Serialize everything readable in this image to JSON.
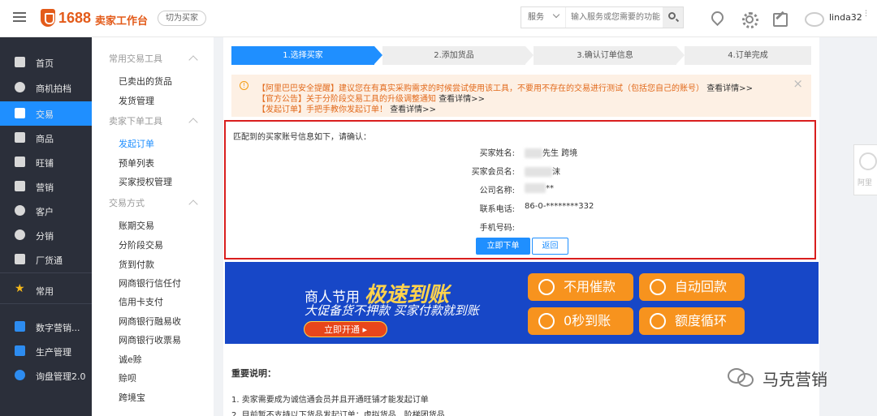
{
  "header": {
    "logo_number": "1688",
    "logo_text": "卖家工作台",
    "switch_label": "切为买家",
    "search_scope": "服务",
    "search_placeholder": "输入服务或您需要的功能",
    "username": "linda32",
    "more": "⋮"
  },
  "sidebar": {
    "items": [
      {
        "label": "首页"
      },
      {
        "label": "商机拍档"
      },
      {
        "label": "交易",
        "active": true
      },
      {
        "label": "商品"
      },
      {
        "label": "旺铺"
      },
      {
        "label": "营销"
      },
      {
        "label": "客户"
      },
      {
        "label": "分销"
      },
      {
        "label": "厂货通"
      },
      {
        "label": "常用"
      },
      {
        "label": "数字营销..."
      },
      {
        "label": "生产管理"
      },
      {
        "label": "询盘管理2.0"
      }
    ]
  },
  "submenu": {
    "groups": [
      {
        "title": "常用交易工具",
        "items": [
          "已卖出的货品",
          "发货管理"
        ]
      },
      {
        "title": "卖家下单工具",
        "items": [
          "发起订单",
          "预单列表",
          "买家授权管理"
        ]
      },
      {
        "title": "交易方式",
        "items": [
          "账期交易",
          "分阶段交易",
          "货到付款",
          "网商银行信任付",
          "信用卡支付",
          "网商银行融易收",
          "网商银行收票易",
          "诚e赊",
          "赊呗",
          "跨境宝"
        ]
      }
    ],
    "active_item": "发起订单"
  },
  "steps": [
    "1.选择买家",
    "2.添加货品",
    "3.确认订单信息",
    "4.订单完成"
  ],
  "notice": {
    "lines": [
      {
        "text": "【阿里巴巴安全提醒】建议您在有真实采购需求的时候尝试使用该工具，不要用不存在的交易进行测试（包括您自己的账号）",
        "link": "查看详情>>"
      },
      {
        "text": "【官方公告】关于分阶段交易工具的升级调整通知",
        "link": "查看详情>>"
      },
      {
        "text": "【发起订单】手把手教你发起订单！",
        "link": "查看详情>>"
      }
    ],
    "close": "×"
  },
  "confirm": {
    "title": "匹配到的买家账号信息如下，请确认：",
    "fields": [
      {
        "label": "买家姓名:",
        "value": "先生 跨境"
      },
      {
        "label": "买家会员名:",
        "value": "沫"
      },
      {
        "label": "公司名称:",
        "value": "**"
      },
      {
        "label": "联系电话:",
        "value": "86-0-********332"
      },
      {
        "label": "手机号码:",
        "value": ""
      }
    ],
    "submit_label": "立即下单",
    "back_label": "返回"
  },
  "banner": {
    "line1": "商人节用",
    "line1_highlight": "极速到账",
    "line2": "大促备货不押款 买家付款就到账",
    "cta": "立即开通 ▸",
    "features": [
      "不用催款",
      "自动回款",
      "0秒到账",
      "额度循环"
    ]
  },
  "notes": {
    "title": "重要说明：",
    "lines": [
      "1. 卖家需要成为诚信通会员并且开通旺铺才能发起订单",
      "2. 目前暂不支持以下货品发起订单：虚拟货品、阶梯团货品"
    ]
  },
  "side_widget": {
    "label": "阿里"
  },
  "watermark": {
    "text": "马克营销"
  }
}
